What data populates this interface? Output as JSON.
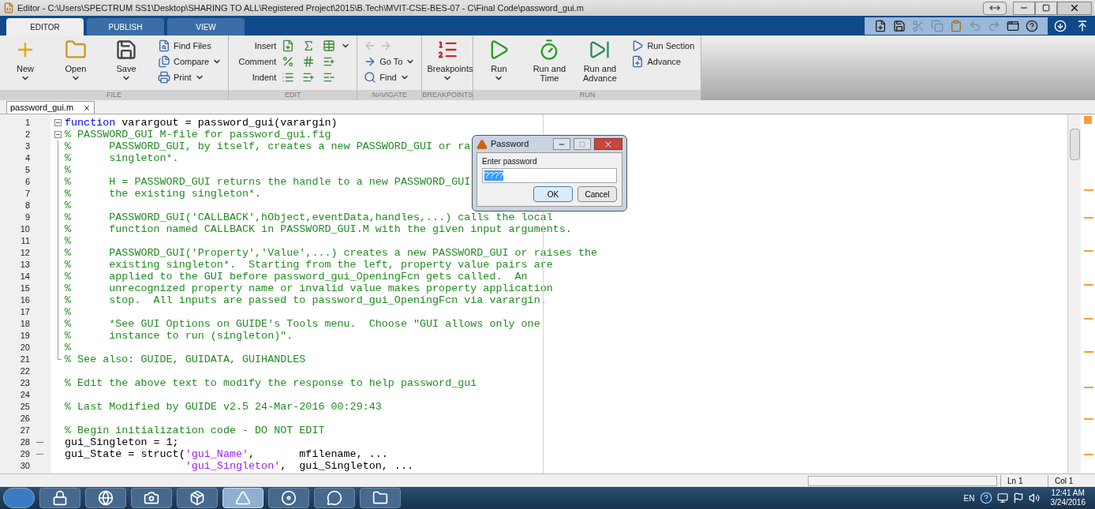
{
  "window": {
    "title": "Editor - C:\\Users\\SPECTRUM SS1\\Desktop\\SHARING TO ALL\\Registered Project\\2015\\B.Tech\\MVIT-CSE-BES-07 - C\\Final Code\\password_gui.m"
  },
  "ribbon_tabs": [
    {
      "label": "EDITOR",
      "selected": true
    },
    {
      "label": "PUBLISH",
      "selected": false
    },
    {
      "label": "VIEW",
      "selected": false
    }
  ],
  "toolstrip": [
    {
      "title": "FILE",
      "items": [
        {
          "kind": "large",
          "label": "New",
          "dropdown": true
        },
        {
          "kind": "large",
          "label": "Open",
          "dropdown": true
        },
        {
          "kind": "large",
          "label": "Save",
          "dropdown": true
        },
        {
          "kind": "stack",
          "rows": [
            {
              "kind": "button",
              "label": "Find Files",
              "dropdown": false
            },
            {
              "kind": "button",
              "label": "Compare",
              "dropdown": true
            },
            {
              "kind": "button",
              "label": "Print",
              "dropdown": true
            }
          ]
        }
      ]
    },
    {
      "title": "EDIT",
      "items": [
        {
          "kind": "iconrows",
          "rows": [
            {
              "label": "Insert",
              "dropdown": true
            },
            {
              "label": "Comment",
              "dropdown": false
            },
            {
              "label": "Indent",
              "dropdown": false
            }
          ]
        }
      ]
    },
    {
      "title": "NAVIGATE",
      "items": [
        {
          "kind": "stack",
          "rows": [
            {
              "kind": "arrows",
              "disabled": true
            },
            {
              "kind": "button",
              "label": "Go To",
              "dropdown": true
            },
            {
              "kind": "button",
              "label": "Find",
              "dropdown": true
            }
          ]
        }
      ]
    },
    {
      "title": "BREAKPOINTS",
      "items": [
        {
          "kind": "large",
          "label": "Breakpoints",
          "dropdown": true
        }
      ]
    },
    {
      "title": "RUN",
      "items": [
        {
          "kind": "large",
          "label": "Run",
          "dropdown": true
        },
        {
          "kind": "large",
          "label": "Run and Time",
          "dropdown": false
        },
        {
          "kind": "large",
          "label": "Run and Advance",
          "dropdown": false
        },
        {
          "kind": "stack",
          "rows": [
            {
              "kind": "button",
              "label": "Run Section",
              "dropdown": false
            },
            {
              "kind": "button",
              "label": "Advance",
              "dropdown": false
            }
          ]
        }
      ]
    }
  ],
  "document_tabs": [
    {
      "label": "password_gui.m",
      "selected": true
    }
  ],
  "code_lines": [
    {
      "n": "1",
      "kind": "fold_start",
      "segments": [
        {
          "kind": "keyword",
          "text": "function"
        },
        {
          "kind": "plain",
          "text": " varargout = password_gui(varargin)"
        }
      ]
    },
    {
      "n": "2",
      "kind": "fold_start",
      "segments": [
        {
          "kind": "comment",
          "text": "% PASSWORD_GUI M-file for password_gui.fig"
        }
      ]
    },
    {
      "n": "3",
      "kind": "fold_body",
      "segments": [
        {
          "kind": "comment",
          "text": "%      PASSWORD_GUI, by itself, creates a new PASSWORD_GUI or ra"
        }
      ]
    },
    {
      "n": "4",
      "kind": "fold_body",
      "segments": [
        {
          "kind": "comment",
          "text": "%      singleton*."
        }
      ]
    },
    {
      "n": "5",
      "kind": "fold_body",
      "segments": [
        {
          "kind": "comment",
          "text": "%"
        }
      ]
    },
    {
      "n": "6",
      "kind": "fold_body",
      "segments": [
        {
          "kind": "comment",
          "text": "%      H = PASSWORD_GUI returns the handle to a new PASSWORD_GUI"
        }
      ]
    },
    {
      "n": "7",
      "kind": "fold_body",
      "segments": [
        {
          "kind": "comment",
          "text": "%      the existing singleton*."
        }
      ]
    },
    {
      "n": "8",
      "kind": "fold_body",
      "segments": [
        {
          "kind": "comment",
          "text": "%"
        }
      ]
    },
    {
      "n": "9",
      "kind": "fold_body",
      "segments": [
        {
          "kind": "comment",
          "text": "%      PASSWORD_GUI('CALLBACK',hObject,eventData,handles,...) calls the local"
        }
      ]
    },
    {
      "n": "10",
      "kind": "fold_body",
      "segments": [
        {
          "kind": "comment",
          "text": "%      function named CALLBACK in PASSWORD_GUI.M with the given input arguments."
        }
      ]
    },
    {
      "n": "11",
      "kind": "fold_body",
      "segments": [
        {
          "kind": "comment",
          "text": "%"
        }
      ]
    },
    {
      "n": "12",
      "kind": "fold_body",
      "segments": [
        {
          "kind": "comment",
          "text": "%      PASSWORD_GUI('Property','Value',...) creates a new PASSWORD_GUI or raises the"
        }
      ]
    },
    {
      "n": "13",
      "kind": "fold_body",
      "segments": [
        {
          "kind": "comment",
          "text": "%      existing singleton*.  Starting from the left, property value pairs are"
        }
      ]
    },
    {
      "n": "14",
      "kind": "fold_body",
      "segments": [
        {
          "kind": "comment",
          "text": "%      applied to the GUI before password_gui_OpeningFcn gets called.  An"
        }
      ]
    },
    {
      "n": "15",
      "kind": "fold_body",
      "segments": [
        {
          "kind": "comment",
          "text": "%      unrecognized property name or invalid value makes property application"
        }
      ]
    },
    {
      "n": "16",
      "kind": "fold_body",
      "segments": [
        {
          "kind": "comment",
          "text": "%      stop.  All inputs are passed to password_gui_OpeningFcn via varargin."
        }
      ]
    },
    {
      "n": "17",
      "kind": "fold_body",
      "segments": [
        {
          "kind": "comment",
          "text": "%"
        }
      ]
    },
    {
      "n": "18",
      "kind": "fold_body",
      "segments": [
        {
          "kind": "comment",
          "text": "%      *See GUI Options on GUIDE's Tools menu.  Choose \"GUI allows only one"
        }
      ]
    },
    {
      "n": "19",
      "kind": "fold_body",
      "segments": [
        {
          "kind": "comment",
          "text": "%      instance to run (singleton)\"."
        }
      ]
    },
    {
      "n": "20",
      "kind": "fold_body",
      "segments": [
        {
          "kind": "comment",
          "text": "%"
        }
      ]
    },
    {
      "n": "21",
      "kind": "fold_end",
      "segments": [
        {
          "kind": "comment",
          "text": "% See also: GUIDE, GUIDATA, GUIHANDLES"
        }
      ]
    },
    {
      "n": "22",
      "kind": "plain"
    },
    {
      "n": "23",
      "kind": "plain",
      "segments": [
        {
          "kind": "comment",
          "text": "% Edit the above text to modify the response to help password_gui"
        }
      ]
    },
    {
      "n": "24",
      "kind": "plain"
    },
    {
      "n": "25",
      "kind": "plain",
      "segments": [
        {
          "kind": "comment",
          "text": "% Last Modified by GUIDE v2.5 24-Mar-2016 00:29:43"
        }
      ]
    },
    {
      "n": "26",
      "kind": "plain"
    },
    {
      "n": "27",
      "kind": "plain",
      "segments": [
        {
          "kind": "comment",
          "text": "% Begin initialization code - DO NOT EDIT"
        }
      ]
    },
    {
      "n": "28",
      "kind": "plain",
      "marker": "—",
      "segments": [
        {
          "kind": "plain",
          "text": "gui_Singleton = 1;"
        }
      ]
    },
    {
      "n": "29",
      "kind": "plain",
      "marker": "—",
      "segments": [
        {
          "kind": "plain",
          "text": "gui_State = struct("
        },
        {
          "kind": "string",
          "text": "'gui_Name'"
        },
        {
          "kind": "plain",
          "text": ",       mfilename, ..."
        }
      ]
    },
    {
      "n": "30",
      "kind": "plain",
      "segments": [
        {
          "kind": "string",
          "text": "                   'gui_Singleton'"
        },
        {
          "kind": "plain",
          "text": ",  gui_Singleton, ..."
        }
      ]
    }
  ],
  "dialog": {
    "title": "Password",
    "prompt": "Enter password",
    "value": "????",
    "value_selected": true,
    "buttons": [
      {
        "label": "OK",
        "default": true
      },
      {
        "label": "Cancel",
        "default": false
      }
    ]
  },
  "status_bar": {
    "line": "Ln 1",
    "column": "Col 1"
  },
  "taskbar": {
    "apps": [
      {
        "active": false
      },
      {
        "active": false
      },
      {
        "active": false
      },
      {
        "active": false
      },
      {
        "active": true
      },
      {
        "active": false
      },
      {
        "active": false
      },
      {
        "active": false
      }
    ],
    "language": "EN",
    "time": "12:41 AM",
    "date": "3/24/2016"
  }
}
